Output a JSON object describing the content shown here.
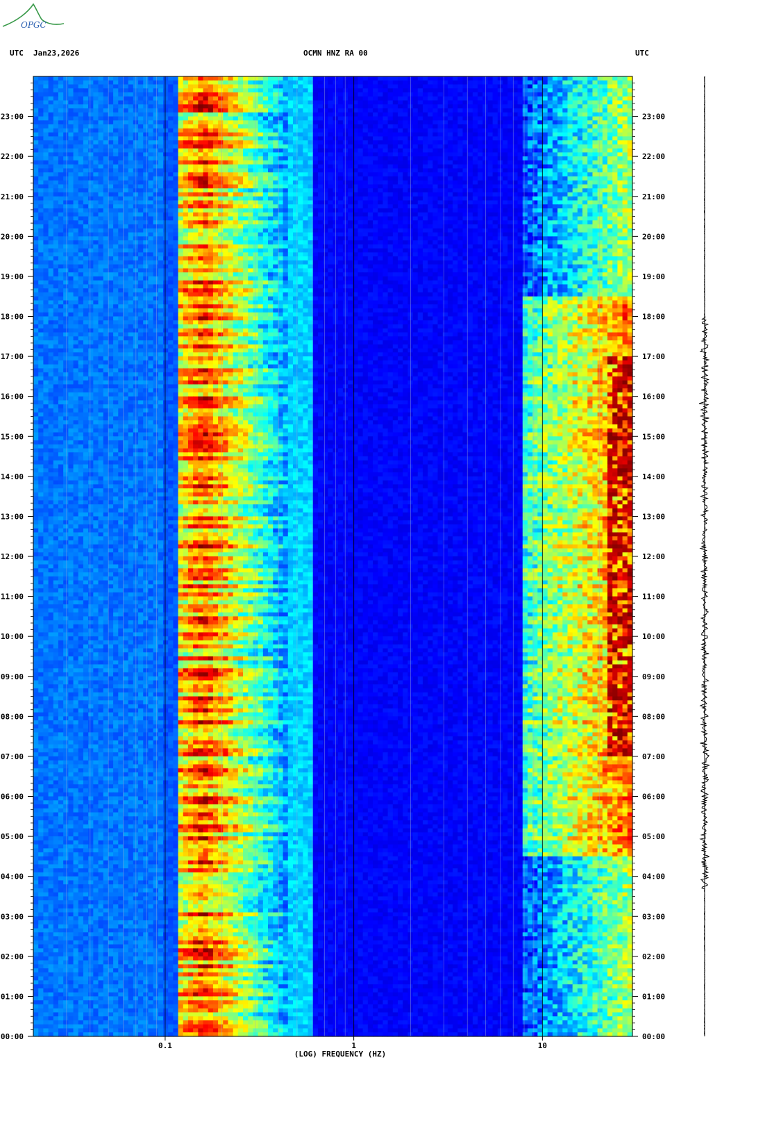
{
  "header": {
    "left_tz": "UTC",
    "date": "Jan23,2026",
    "station": "OCMN HNZ RA 00",
    "right_tz": "UTC"
  },
  "logo": {
    "text": "OPGC"
  },
  "chart_data": {
    "type": "heatmap",
    "title": "OCMN HNZ RA 00",
    "date": "Jan23,2026",
    "xlabel": "(LOG) FREQUENCY (HZ)",
    "x_scale": "log",
    "x_range_hz": [
      0.02,
      30
    ],
    "x_tick_labels": [
      "0.1",
      "1",
      "10"
    ],
    "y_range": [
      "00:00",
      "24:00"
    ],
    "y_tick_labels": [
      "00:00",
      "01:00",
      "02:00",
      "03:00",
      "04:00",
      "05:00",
      "06:00",
      "07:00",
      "08:00",
      "09:00",
      "10:00",
      "11:00",
      "12:00",
      "13:00",
      "14:00",
      "15:00",
      "16:00",
      "17:00",
      "18:00",
      "19:00",
      "20:00",
      "21:00",
      "22:00",
      "23:00"
    ],
    "colormap": "jet",
    "features": {
      "microseism_band_hz": [
        0.12,
        0.45
      ],
      "microseism_peak_hz": 0.16,
      "high_frequency_activity_hz": [
        8,
        30
      ],
      "high_frequency_active_hours": [
        4.5,
        18.5
      ]
    }
  },
  "colors": {
    "background": "#ffffff",
    "low": "#0a1fb0",
    "high": "#a00000"
  }
}
